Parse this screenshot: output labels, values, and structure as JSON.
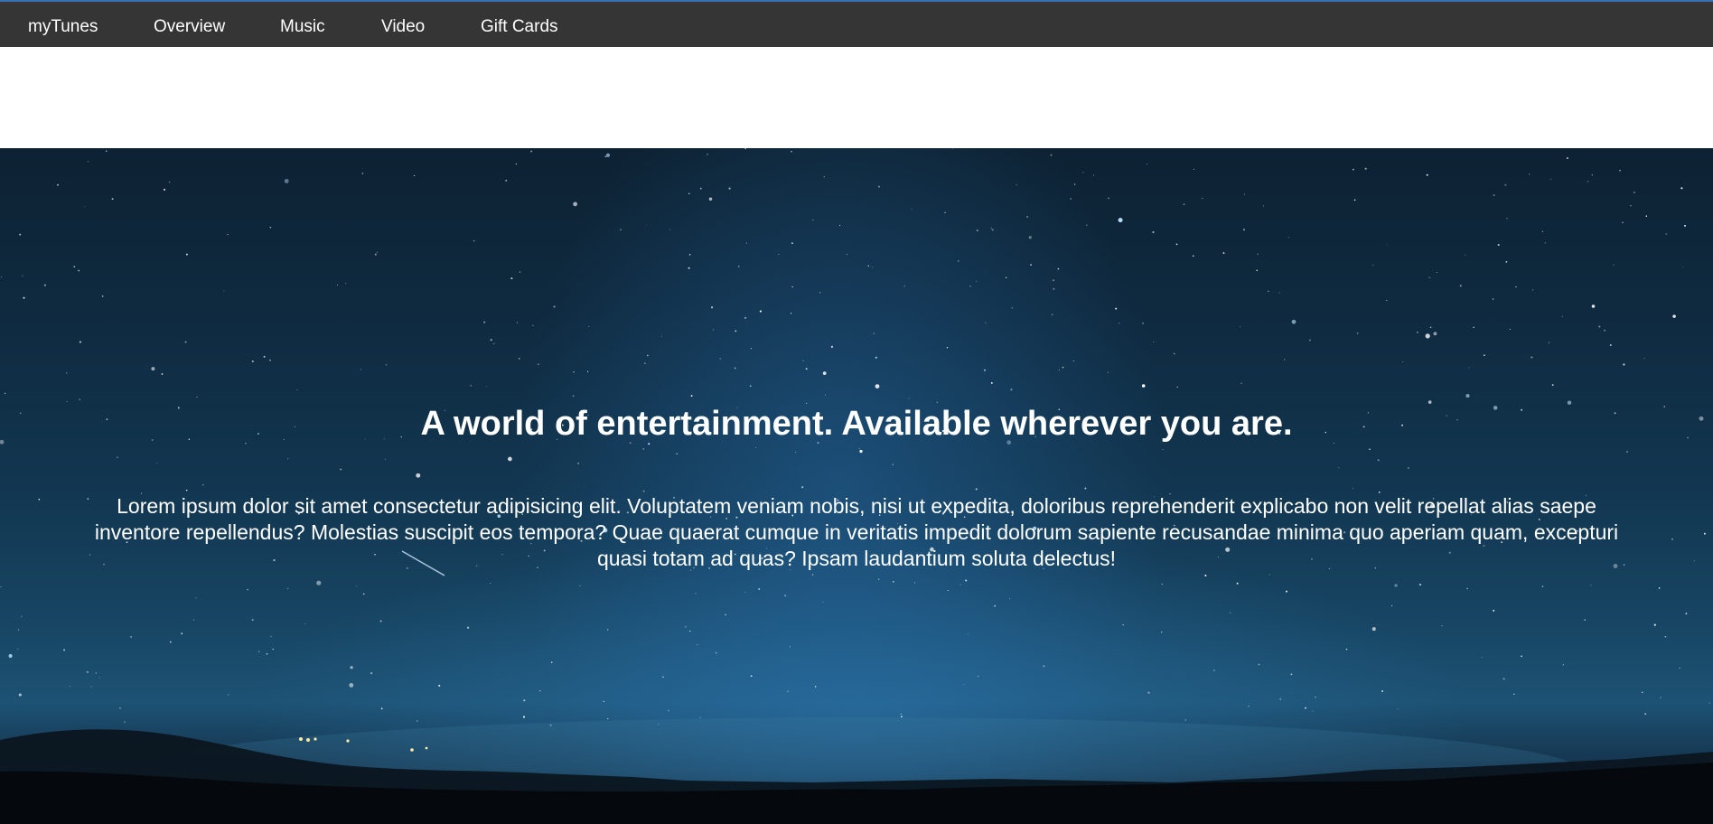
{
  "nav": {
    "brand": "myTunes",
    "items": [
      {
        "label": "Overview"
      },
      {
        "label": "Music"
      },
      {
        "label": "Video"
      },
      {
        "label": "Gift Cards"
      }
    ]
  },
  "hero": {
    "title": "A world of entertainment. Available wherever you are.",
    "body": "Lorem ipsum dolor sit amet consectetur adipisicing elit. Voluptatem veniam nobis, nisi ut expedita, doloribus reprehenderit explicabo non velit repellat alias saepe inventore repellendus? Molestias suscipit eos tempora? Quae quaerat cumque in veritatis impedit dolorum sapiente recusandae minima quo aperiam quam, excepturi quasi totam ad quas? Ipsam laudantium soluta delectus!"
  },
  "colors": {
    "navbar_bg": "#353535",
    "accent": "#3a6fb0",
    "text": "#ffffff"
  }
}
